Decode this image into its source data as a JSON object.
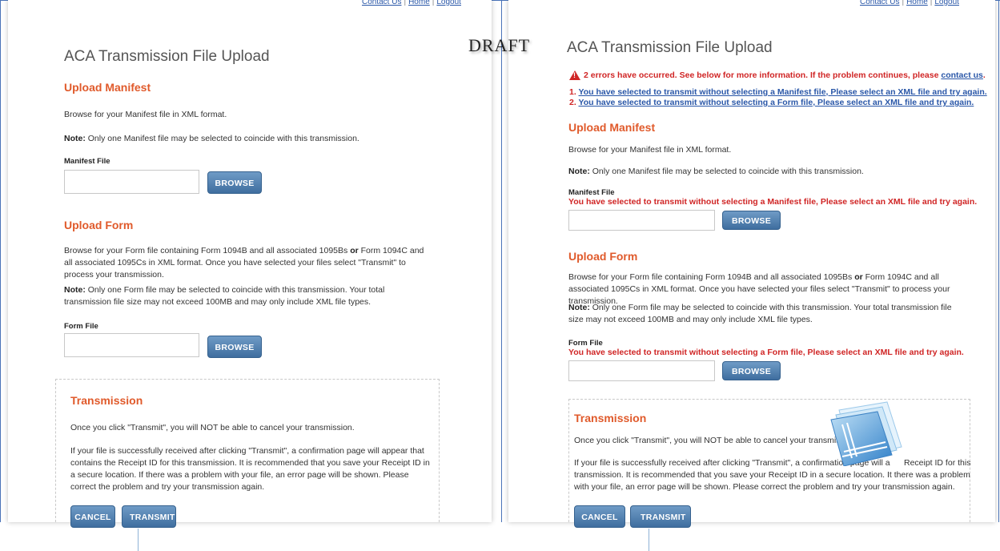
{
  "toplinks": [
    "Contact Us",
    "Home",
    "Logout"
  ],
  "draft_label": "DRAFT",
  "left": {
    "page_title": "ACA Transmission File Upload",
    "manifest": {
      "heading": "Upload Manifest",
      "browse_text": "Browse for your Manifest file in XML format.",
      "note_prefix": "Note:",
      "note_text": " Only one Manifest file may be selected to coincide with this transmission.",
      "field_label": "Manifest File",
      "input_value": "",
      "browse_button": "BROWSE"
    },
    "form": {
      "heading": "Upload Form",
      "browse_text_1": "Browse for your Form file containing Form 1094B and all associated 1095Bs ",
      "browse_text_or": "or",
      "browse_text_2": " Form 1094C and all associated 1095Cs in XML format. Once you have selected your files select \"Transmit\" to process your transmission.",
      "note_prefix": "Note:",
      "note_text": " Only one Form file may be selected to coincide with this transmission. Your total transmission file size may not exceed 100MB and may only include XML file types.",
      "field_label": "Form File",
      "input_value": "",
      "browse_button": "BROWSE"
    },
    "transmission": {
      "heading": "Transmission",
      "text_1": "Once you click \"Transmit\", you will NOT be able to cancel your transmission.",
      "text_2": "If your file is successfully received after clicking \"Transmit\", a confirmation page will appear that contains the Receipt ID for this transmission. It is recommended that you save your Receipt ID in a secure location. If there was a problem with your file, an error page will be shown. Please correct the problem and try your transmission again.",
      "cancel_button": "CANCEL",
      "transmit_button": "TRANSMIT"
    }
  },
  "right": {
    "page_title": "ACA Transmission File Upload",
    "alert": {
      "text": "2 errors have occurred. See below for more information. If the problem continues, please ",
      "link": "contact us",
      "end": "."
    },
    "errors": [
      {
        "num": "1.",
        "text": "You have selected to transmit without selecting a Manifest file, Please select an XML file and try again."
      },
      {
        "num": "2.",
        "text": "You have selected to transmit without selecting a Form file, Please select an XML file and try again."
      }
    ],
    "manifest": {
      "heading": "Upload Manifest",
      "browse_text": "Browse for your Manifest file in XML format.",
      "note_prefix": "Note:",
      "note_text": " Only one Manifest file may be selected to coincide with this transmission.",
      "field_label": "Manifest File",
      "error": "You have selected to transmit without selecting a Manifest file, Please select an XML file and try again.",
      "input_value": "",
      "browse_button": "BROWSE"
    },
    "form": {
      "heading": "Upload Form",
      "browse_text_1": "Browse for your Form file containing Form 1094B and all associated 1095Bs ",
      "browse_text_or": "or",
      "browse_text_2": " Form 1094C and all associated 1095Cs in XML format. Once you have selected your files select \"Transmit\" to process your transmission.",
      "note_prefix": "Note:",
      "note_text": " Only one Form file may be selected to coincide with this transmission. Your total transmission file size may not exceed 100MB and may only include XML file types.",
      "field_label": "Form File",
      "error": "You have selected to transmit without selecting a Form file, Please select an XML file and try again.",
      "input_value": "",
      "browse_button": "BROWSE"
    },
    "transmission": {
      "heading": "Transmission",
      "text_1": "Once you click \"Transmit\", you will NOT be able to cancel your transmission.",
      "text_2a": "If your file is successfully received after clicking \"Transmit\", a confirmation page will a",
      "text_2b": "Receipt ID for this",
      "text_2c": "transmission. It is recommended that you save your Receipt ID in a secure location. It there was a problem with your file, an error page will be shown. Please correct the problem and try your transmission again.",
      "cancel_button": "CANCEL",
      "transmit_button": "TRANSMIT"
    }
  },
  "colors": {
    "heading": "#e05a2b",
    "error": "#d02525",
    "link": "#2a57a8",
    "button": "#4f7fb0"
  }
}
